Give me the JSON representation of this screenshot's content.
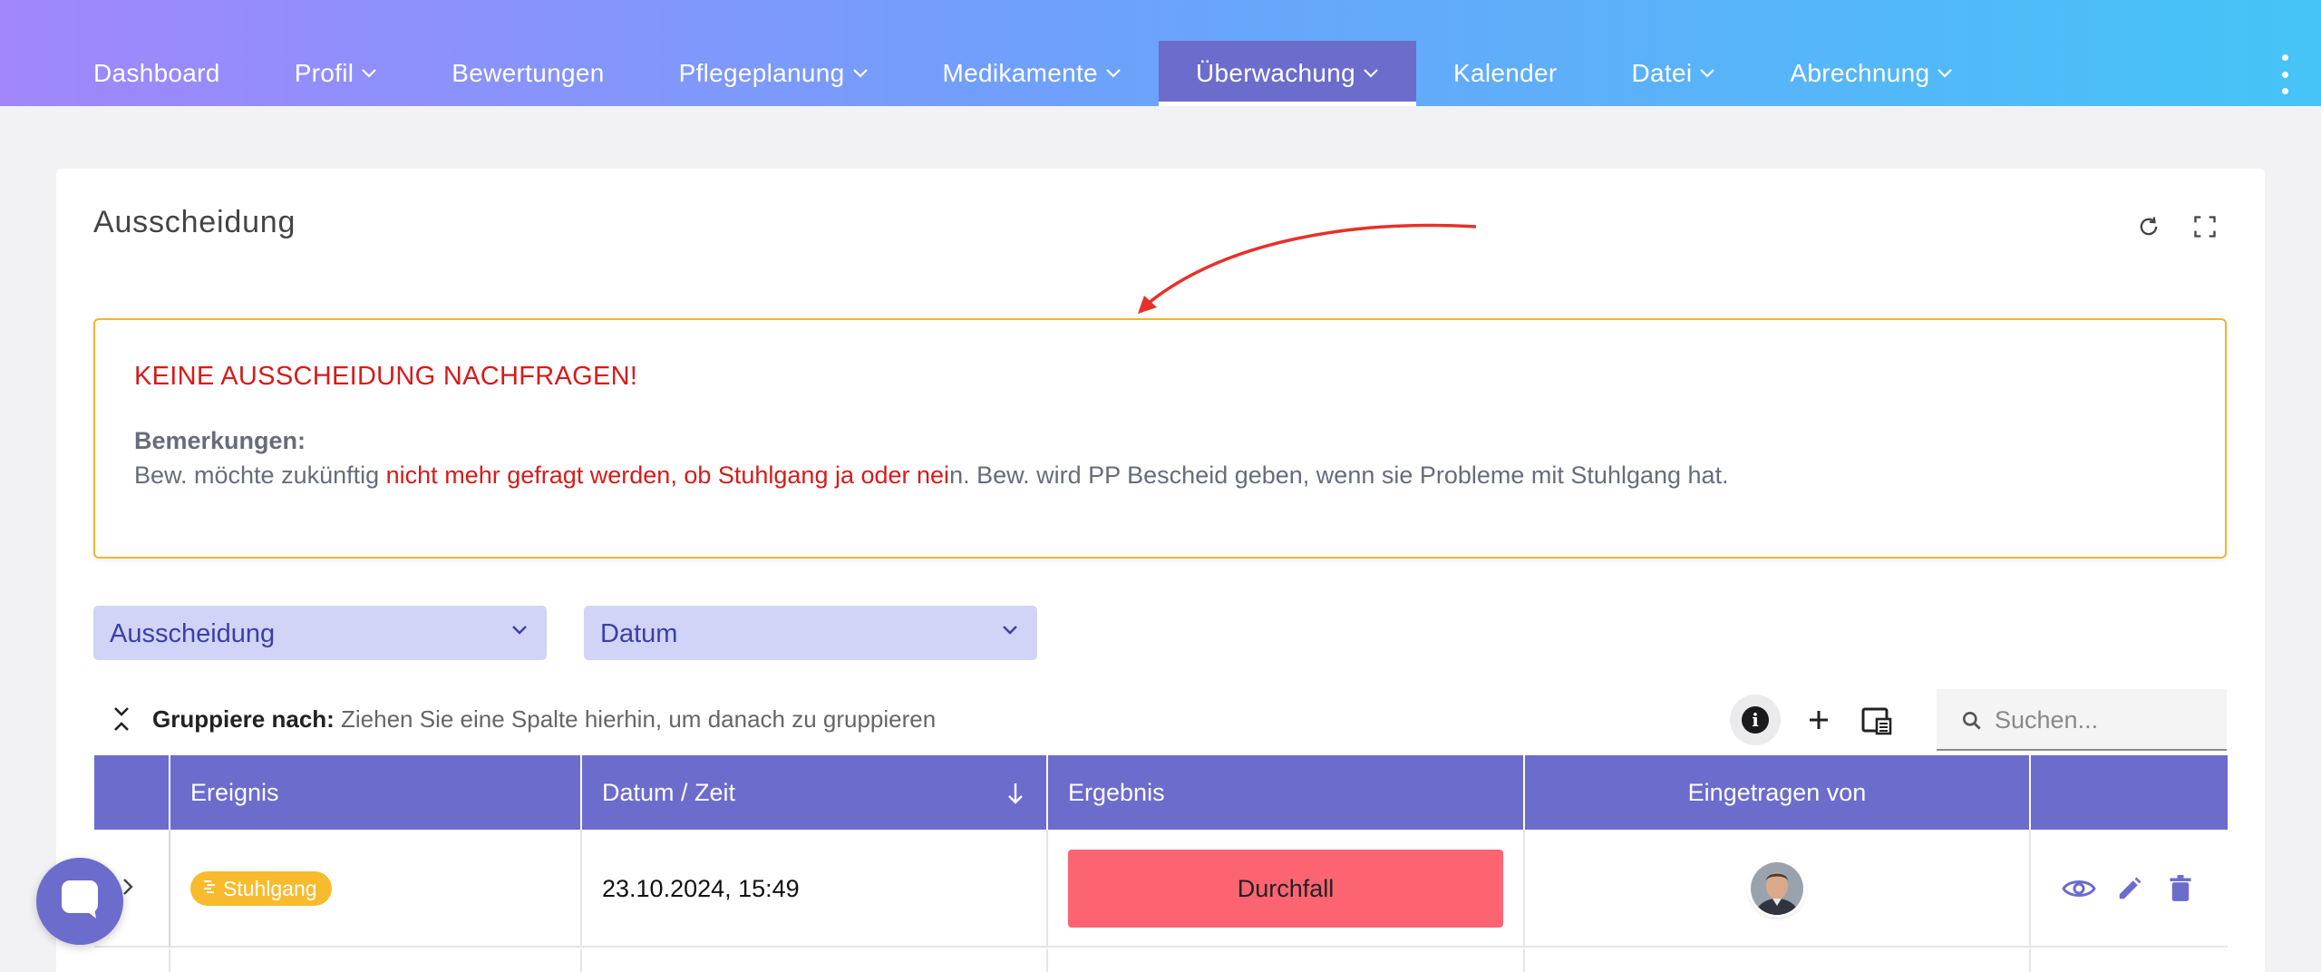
{
  "nav": {
    "items": [
      {
        "label": "Dashboard",
        "dropdown": false
      },
      {
        "label": "Profil",
        "dropdown": true
      },
      {
        "label": "Bewertungen",
        "dropdown": false
      },
      {
        "label": "Pflegeplanung",
        "dropdown": true
      },
      {
        "label": "Medikamente",
        "dropdown": true
      },
      {
        "label": "Überwachung",
        "dropdown": true,
        "active": true
      },
      {
        "label": "Kalender",
        "dropdown": false
      },
      {
        "label": "Datei",
        "dropdown": true
      },
      {
        "label": "Abrechnung",
        "dropdown": true
      }
    ]
  },
  "card": {
    "title": "Ausscheidung"
  },
  "alert": {
    "heading": "KEINE AUSSCHEIDUNG NACHFRAGEN!",
    "remarks_label": "Bemerkungen:",
    "text_before": "Bew. möchte zukünftig ",
    "text_highlight": "nicht mehr gefragt werden, ob Stuhlgang ja oder nei",
    "text_after": "n. Bew. wird PP Bescheid geben, wenn sie Probleme mit Stuhlgang hat."
  },
  "filters": {
    "type_value": "Ausscheidung",
    "date_value": "Datum"
  },
  "grouping": {
    "label": "Gruppiere nach:",
    "hint": "Ziehen Sie eine Spalte hierhin, um danach zu gruppieren"
  },
  "search": {
    "placeholder": "Suchen..."
  },
  "table": {
    "columns": [
      "Ereignis",
      "Datum / Zeit",
      "Ergebnis",
      "Eingetragen von"
    ],
    "rows": [
      {
        "event": "Stuhlgang",
        "datetime": "23.10.2024, 15:49",
        "result": "Durchfall"
      }
    ]
  },
  "colors": {
    "accent": "#6b6ccc",
    "alert_border": "#f2b531",
    "alert_red": "#d61b1b",
    "tag_yellow": "#f8bb2d",
    "result_red": "#fc6472",
    "select_bg": "#d1d4f7"
  }
}
